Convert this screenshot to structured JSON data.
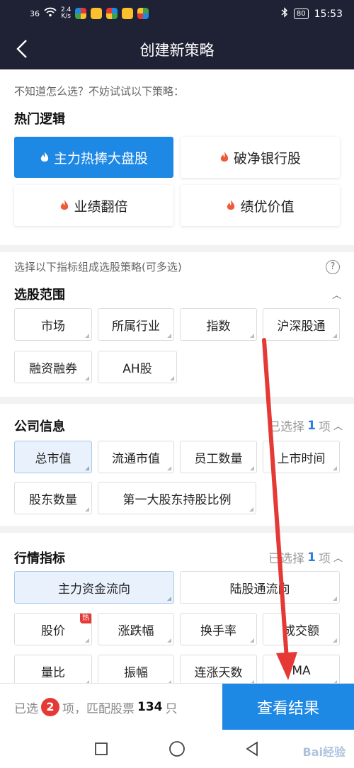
{
  "status_bar": {
    "signal": "36",
    "speed_value": "2.4",
    "speed_unit": "K/s",
    "battery": "80",
    "time": "15:53"
  },
  "header": {
    "title": "创建新策略"
  },
  "strategy": {
    "hint": "不知道怎么选？不妨试试以下策略：",
    "title": "热门逻辑",
    "cards": [
      "主力热捧大盘股",
      "破净银行股",
      "业绩翻倍",
      "绩优价值"
    ]
  },
  "indicators": {
    "hint": "选择以下指标组成选股策略(可多选)",
    "help": "?"
  },
  "scope": {
    "title": "选股范围",
    "chips": [
      "市场",
      "所属行业",
      "指数",
      "沪深股通",
      "融资融券",
      "AH股"
    ]
  },
  "company": {
    "title": "公司信息",
    "selected_prefix": "已选择",
    "selected_count": "1",
    "selected_suffix": "项",
    "chips": [
      "总市值",
      "流通市值",
      "员工数量",
      "上市时间",
      "股东数量",
      "第一大股东持股比例"
    ]
  },
  "market": {
    "title": "行情指标",
    "selected_prefix": "已选择",
    "selected_count": "1",
    "selected_suffix": "项",
    "chips": [
      "主力资金流向",
      "陆股通流向",
      "股价",
      "涨跌幅",
      "换手率",
      "成交额",
      "量比",
      "振幅",
      "连涨天数",
      "MA"
    ],
    "hot_badge": "热"
  },
  "bottom": {
    "selected_prefix": "已选",
    "selected_count": "2",
    "selected_mid": "项，匹配股票",
    "matched_count": "134",
    "matched_unit": "只",
    "result_button": "查看结果"
  },
  "watermark": "Bai经验",
  "colors": {
    "header_bg": "#1f2235",
    "accent": "#1e88e5",
    "badge_red": "#e53935",
    "annotation_arrow": "#e53935"
  }
}
